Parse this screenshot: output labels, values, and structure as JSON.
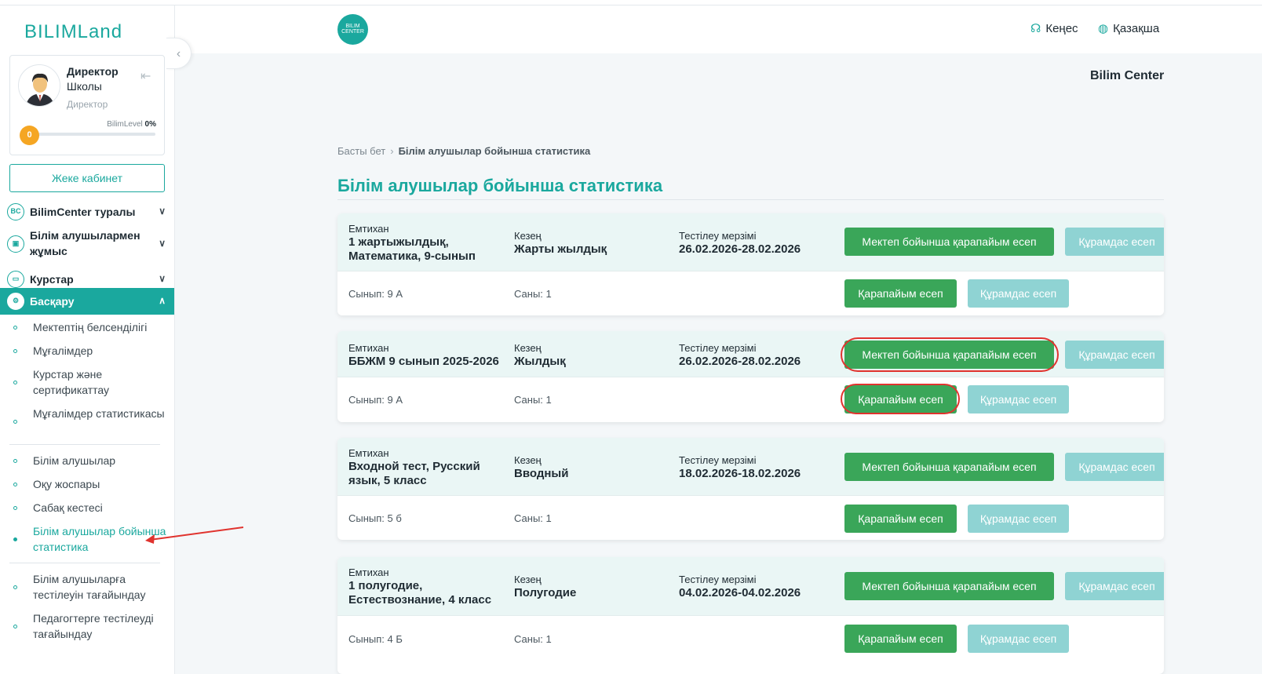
{
  "sidebar": {
    "logo": "BILIMLand",
    "profile": {
      "name": "Директор",
      "school": "Школы",
      "role": "Директор",
      "level_label": "BilimLevel",
      "level_percent": "0%",
      "level_value": "0"
    },
    "cabinet_button": "Жеке кабинет",
    "menu": [
      {
        "label": "BilimCenter туралы",
        "icon": "BC"
      },
      {
        "label": "Білім алушылармен жұмыс",
        "icon": "case"
      },
      {
        "label": "Курстар",
        "icon": "monitor"
      },
      {
        "label": "Басқару",
        "icon": "gear"
      }
    ],
    "submenu": [
      "Мектептің белсенділігі",
      "Мұғалімдер",
      "Курстар және сертификаттау",
      "Мұғалімдер статистикасы",
      "Білім алушылар",
      "Оқу жоспары",
      "Сабақ кестесі",
      "Білім алушылар бойынша статистика",
      "Білім алушыларға тестілеуін тағайындау",
      "Педагогтерге тестілеуді тағайындау"
    ]
  },
  "header": {
    "center_logo": "BILIM CENTER",
    "help": "Кеңес",
    "language": "Қазақша",
    "center_title": "Bilim Center"
  },
  "breadcrumb": {
    "home": "Басты бет",
    "current": "Білім алушылар бойынша статистика"
  },
  "page_title": "Білім алушылар бойынша статистика",
  "labels": {
    "exam": "Емтихан",
    "period": "Кезең",
    "test_date": "Тестілеу мерзімі",
    "school_simple": "Мектеп бойынша қарапайым есеп",
    "composite": "Құрамдас есеп",
    "simple": "Қарапайым есеп"
  },
  "cards": [
    {
      "exam": "1 жартыжылдық, Математика, 9-сынып",
      "period": "Жарты жылдық",
      "dates": "26.02.2026-28.02.2026",
      "class": "Сынып: 9 А",
      "count": "Саны: 1"
    },
    {
      "exam": "ББЖМ 9 сынып 2025-2026",
      "period": "Жылдық",
      "dates": "26.02.2026-28.02.2026",
      "class": "Сынып: 9 А",
      "count": "Саны: 1"
    },
    {
      "exam": "Входной тест, Русский язык, 5 класс",
      "period": "Вводный",
      "dates": "18.02.2026-18.02.2026",
      "class": "Сынып: 5 б",
      "count": "Саны: 1"
    },
    {
      "exam": "1 полугодие, Естествознание, 4 класс",
      "period": "Полугодие",
      "dates": "04.02.2026-04.02.2026",
      "class": "Сынып: 4 Б",
      "count": "Саны: 1"
    }
  ],
  "colors": {
    "accent": "#1aa89e",
    "green_button": "#3aa659",
    "light_button": "#8fd3d3",
    "highlight": "#e0332e"
  }
}
